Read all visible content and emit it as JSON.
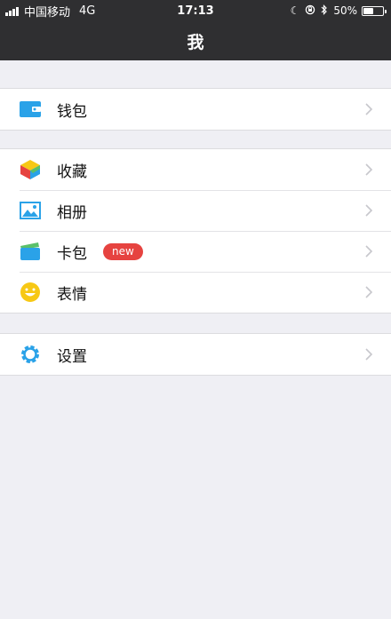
{
  "status_bar": {
    "carrier": "中国移动",
    "network": "4G",
    "time": "17:13",
    "battery_text": "50%",
    "battery_level": 0.5
  },
  "nav": {
    "title": "我"
  },
  "groups": [
    {
      "items": [
        {
          "label": "钱包",
          "icon": "wallet-icon",
          "color": "#2aa2e8"
        }
      ]
    },
    {
      "items": [
        {
          "label": "收藏",
          "icon": "favorites-cube-icon"
        },
        {
          "label": "相册",
          "icon": "album-icon",
          "color": "#2aa2e8"
        },
        {
          "label": "卡包",
          "icon": "card-pack-icon",
          "badge": "new"
        },
        {
          "label": "表情",
          "icon": "emoji-smile-icon",
          "color": "#f7c815"
        }
      ]
    },
    {
      "items": [
        {
          "label": "设置",
          "icon": "settings-gear-icon",
          "color": "#2aa2e8"
        }
      ]
    }
  ],
  "colors": {
    "bar_bg": "#2f2f31",
    "page_bg": "#efeff4",
    "badge_red": "#e64340",
    "accent_blue": "#2aa2e8"
  }
}
